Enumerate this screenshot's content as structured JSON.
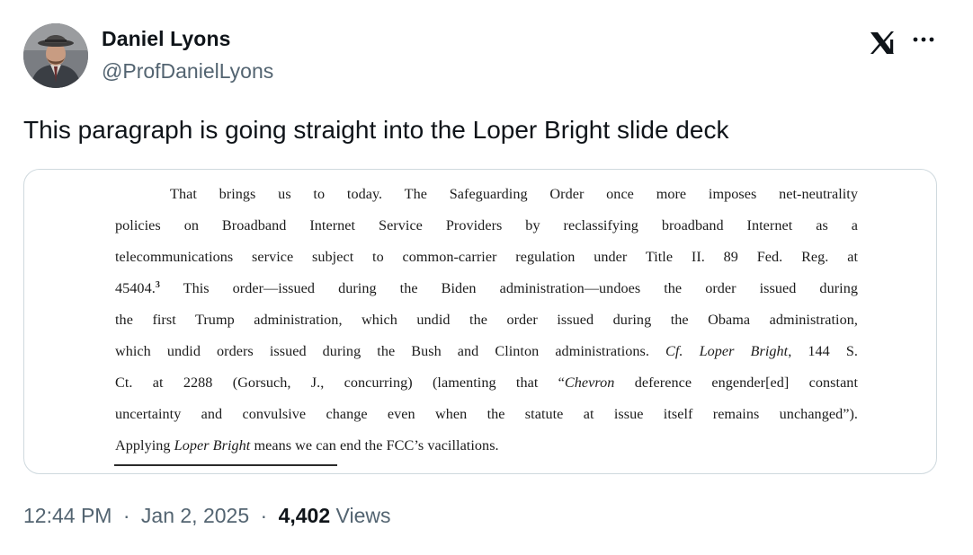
{
  "author": {
    "display_name": "Daniel Lyons",
    "handle": "@ProfDanielLyons",
    "avatar_icon": "user-avatar"
  },
  "tweet": {
    "text": "This paragraph is going straight into the Loper Bright slide deck"
  },
  "document": {
    "line1": "That brings us to today.  The Safeguarding Order once more imposes net-neutrality",
    "line2": "policies on Broadband Internet Service Providers by reclassifying broadband Internet as a",
    "line3": "telecommunications service subject to common-carrier regulation under Title II.  89 Fed. Reg. at",
    "line4_a": "45404.",
    "line4_footnote": "3",
    "line4_b": "  This order—issued during the Biden administration—undoes the order issued during",
    "line5": "the first Trump administration, which undid the order issued during the Obama administration,",
    "line6_a": "which undid orders issued during the Bush and Clinton administrations.  ",
    "line6_cf": "Cf. Loper Bright",
    "line6_b": ", 144 S.",
    "line7_a": "Ct. at 2288 (Gorsuch, J., concurring) (lamenting that “",
    "line7_chevron": "Chevron",
    "line7_b": " deference engender[ed] constant",
    "line8": "uncertainty and convulsive change even when the statute at issue itself remains unchanged”).",
    "line9_a": "Applying ",
    "line9_loper": "Loper Bright",
    "line9_b": " means we can end the FCC’s vacillations."
  },
  "meta": {
    "time": "12:44 PM",
    "separator": "·",
    "date": "Jan 2, 2025",
    "views_count": "4,402",
    "views_label": "Views"
  },
  "icons": {
    "x_logo": "x-logo-icon",
    "more": "more-icon"
  },
  "colors": {
    "text_primary": "#0f1419",
    "text_secondary": "#536471",
    "border": "#cfd9de"
  }
}
